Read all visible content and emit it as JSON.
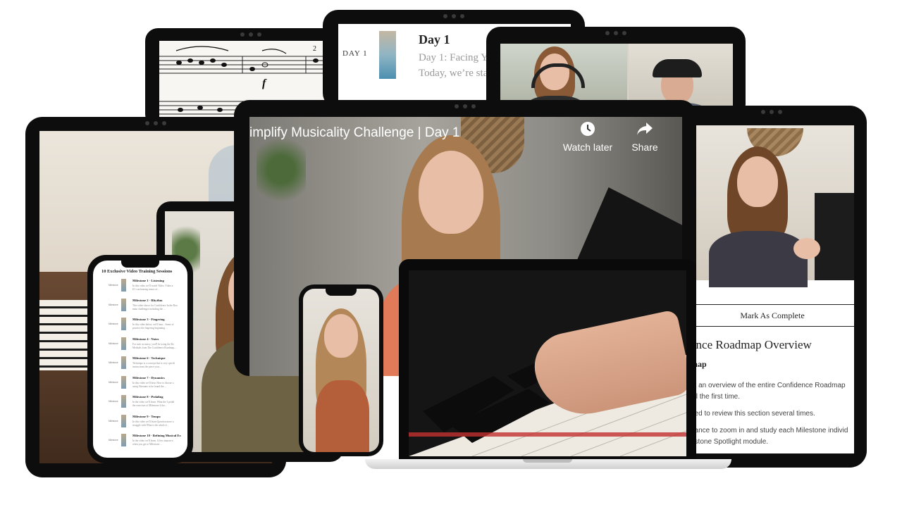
{
  "sheet_music": {
    "dynamic_mark": "f",
    "fingering": "2"
  },
  "daily_lesson": {
    "side_label": "DAY 1",
    "title": "Day 1",
    "subtitle": "Day 1: Facing Yo",
    "body": "Today, we’re star"
  },
  "main_video": {
    "title": "implify Musicality Challenge | Day 1",
    "watch_later_label": "Watch later",
    "share_label": "Share",
    "watch_later_icon": "clock-icon",
    "share_icon": "share-arrow-icon"
  },
  "lesson_panel": {
    "complete_button": "Mark As Complete",
    "heading": "ence Roadmap Overview",
    "subheading": "map",
    "lines": [
      "et an overview of the entire Confidence Roadmap",
      "all the first time.",
      "eed to review this section several times.",
      "hance to zoom in and study each Milestone individ",
      "estone Spotlight module."
    ]
  },
  "phone_list": {
    "title": "10 Exclusive Video Training Sessions",
    "items": [
      {
        "label": "Milestone 1 - Listening",
        "desc1": "In this video we'll watch Video. Video a",
        "desc2": "If I can hearing music of..."
      },
      {
        "label": "Milestone 2 - Rhythm",
        "desc1": "This video shows for Confidence In the Roa",
        "desc2": "main challenges including the ..."
      },
      {
        "label": "Milestone 3 - Fingering",
        "desc1": "In this video below, we'll hear... Some of",
        "desc2": "practice the fingering beginning ..."
      },
      {
        "label": "Milestone 4 - Notes",
        "desc1": "For note accuracy, you'll be using the Ro",
        "desc2": "Methods from The Confidence Roadmap..."
      },
      {
        "label": "Milestone 6 - Technique",
        "desc1": "Technique is a concept that is very specifi",
        "desc2": "instructions the piece your..."
      },
      {
        "label": "Milestone 7 - Dynamics",
        "desc1": "In this video we'll hear. How to choose a",
        "desc2": "using Alternate to be found the ..."
      },
      {
        "label": "Milestone 8 - Pedaling",
        "desc1": "In the video we'll learn. What the 3 pedal",
        "desc2": "the exercises of Milestone 4 the..."
      },
      {
        "label": "Milestone 9 - Tempo",
        "desc1": "In this video we'll learn Question more a",
        "desc2": "struggle with What is the whole d..."
      },
      {
        "label": "Milestone 10 - Refining Musical Ex",
        "desc1": "In the video we'll learn. A few amazin w",
        "desc2": "when you get to Milestone ..."
      }
    ],
    "item_tag": "Milestone"
  },
  "colors": {
    "device_bezel": "#0d0d0d",
    "wall": "#d9d4cc",
    "accent_red": "#e03a3a"
  }
}
